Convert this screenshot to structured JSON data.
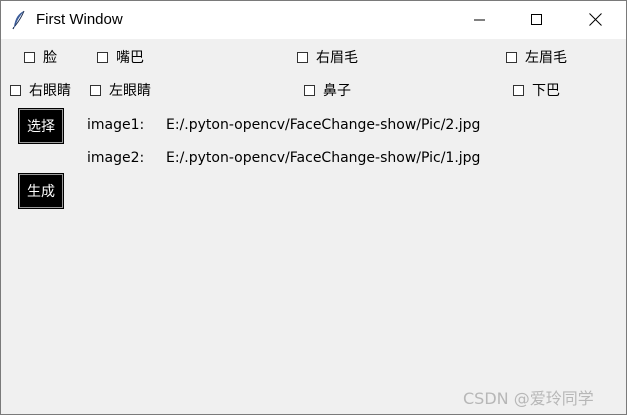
{
  "window": {
    "title": "First Window",
    "icon": "feather-icon",
    "controls": [
      "minimize-icon",
      "maximize-icon",
      "close-icon"
    ]
  },
  "checkboxes": {
    "face": "脸",
    "mouth": "嘴巴",
    "right_eyebrow": "右眉毛",
    "left_eyebrow": "左眉毛",
    "right_eye": "右眼睛",
    "left_eye": "左眼睛",
    "nose": "鼻子",
    "chin": "下巴"
  },
  "buttons": {
    "select_label": "选择",
    "generate_label": "生成"
  },
  "images": [
    {
      "label": "image1:",
      "path": "E:/.pyton-opencv/FaceChange-show/Pic/2.jpg"
    },
    {
      "label": "image2:",
      "path": "E:/.pyton-opencv/FaceChange-show/Pic/1.jpg"
    }
  ],
  "watermark": "CSDN @爱玲同学"
}
